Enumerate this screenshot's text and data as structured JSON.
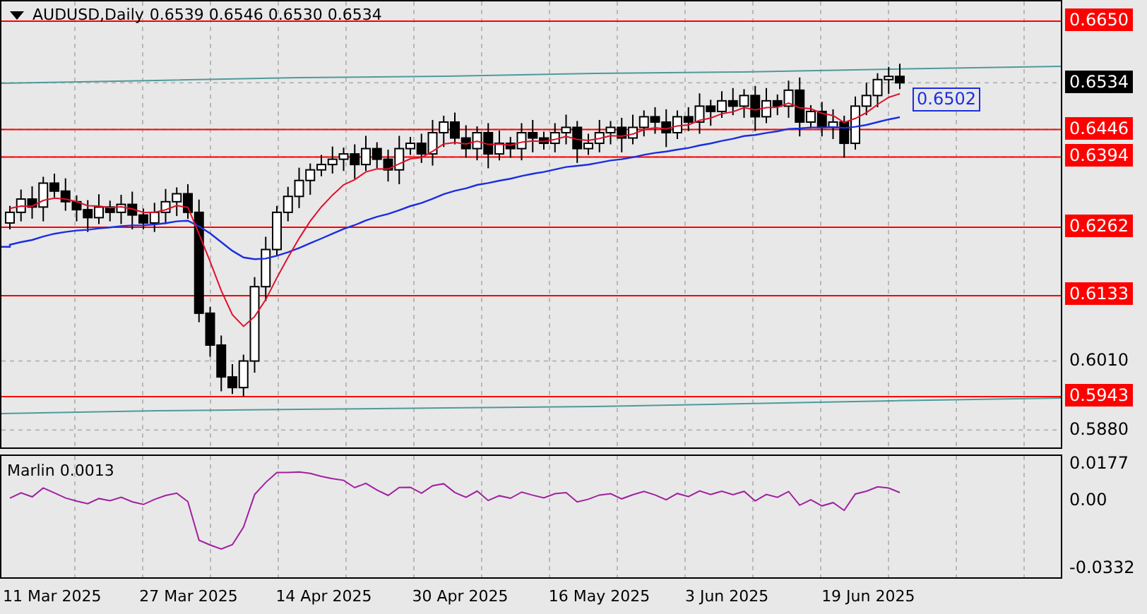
{
  "chart_header": {
    "symbol": "AUDUSD,Daily",
    "quote": "0.6539 0.6546 0.6530 0.6534"
  },
  "price_axis": [
    {
      "label": "0.6650",
      "kind": "level"
    },
    {
      "label": "0.6534",
      "kind": "current"
    },
    {
      "label": "0.6446",
      "kind": "level"
    },
    {
      "label": "0.6394",
      "kind": "level"
    },
    {
      "label": "0.6262",
      "kind": "level"
    },
    {
      "label": "0.6133",
      "kind": "level"
    },
    {
      "label": "0.6010",
      "kind": "tick"
    },
    {
      "label": "0.5943",
      "kind": "level"
    },
    {
      "label": "0.5880",
      "kind": "tick"
    }
  ],
  "moving_average_tag": "0.6502",
  "indicator": {
    "label": "Marlin 0.0013",
    "axis": [
      "0.0177",
      "0.00",
      "-0.0332"
    ]
  },
  "date_axis": [
    "11 Mar 2025",
    "27 Mar 2025",
    "14 Apr 2025",
    "30 Apr 2025",
    "16 May 2025",
    "3 Jun 2025",
    "19 Jun 2025"
  ]
}
